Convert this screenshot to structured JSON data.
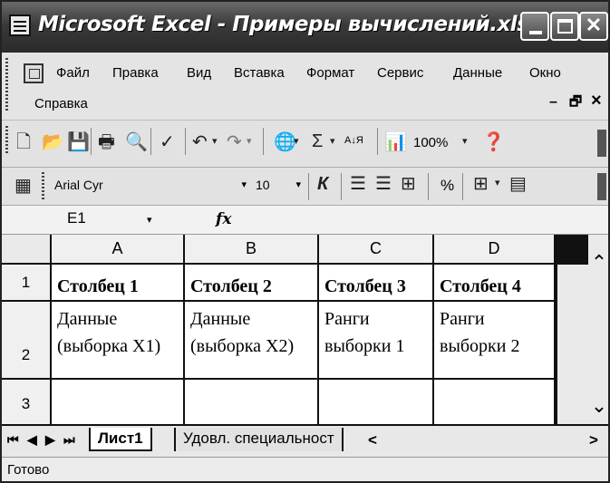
{
  "window": {
    "title": "Microsoft Excel - Примеры вычислений.xls",
    "close_glyph": "✕"
  },
  "menu": {
    "items": [
      "Файл",
      "Правка",
      "Вид",
      "Вставка",
      "Формат",
      "Сервис",
      "Данные",
      "Окно",
      "Справка"
    ],
    "mdi_minimize": "–",
    "mdi_restore": "🗗",
    "mdi_close": "×"
  },
  "toolbar_standard": {
    "zoom": "100%",
    "sigma": "Σ",
    "sort_az": "А↓Я"
  },
  "toolbar_format": {
    "font_name": "Arial Cyr",
    "font_size": "10",
    "italic": "К",
    "percent": "%"
  },
  "formula_bar": {
    "name_box": "E1",
    "fx": "fx",
    "formula": ""
  },
  "grid": {
    "columns": [
      "A",
      "B",
      "C",
      "D"
    ],
    "rows": [
      "1",
      "2",
      "3"
    ],
    "row1": [
      "Столбец 1",
      "Столбец 2",
      "Столбец 3",
      "Столбец 4"
    ],
    "row2": [
      [
        "Данные",
        "(выборка X1)"
      ],
      [
        "Данные",
        "(выборка X2)"
      ],
      [
        "Ранги",
        "выборки 1"
      ],
      [
        "Ранги",
        "выборки 2"
      ]
    ]
  },
  "tabs": {
    "nav": [
      "⏮",
      "◀",
      "▶",
      "⏭"
    ],
    "sheets": [
      "Лист1",
      "Удовл. специальност"
    ],
    "scroll_left": "<",
    "scroll_right": ">"
  },
  "status": {
    "text": "Готово"
  }
}
